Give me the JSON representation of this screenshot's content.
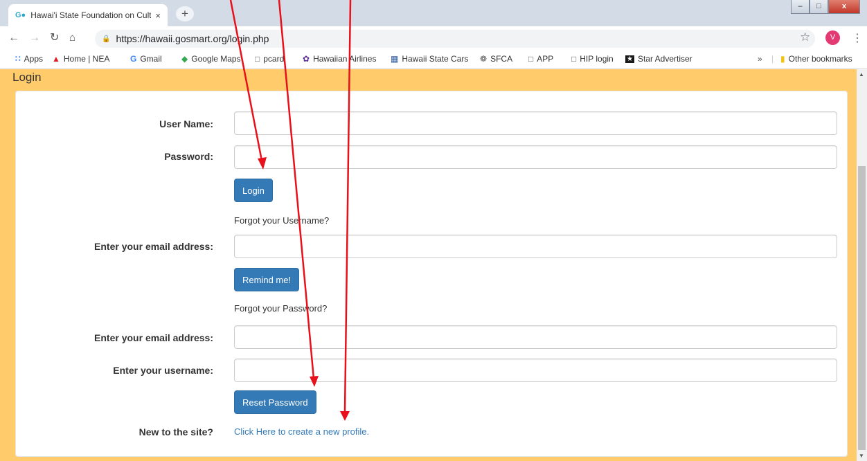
{
  "browser": {
    "tab_title": "Hawai'i State Foundation on Cult",
    "tab_favicon": "G●",
    "tab_close": "×",
    "new_tab": "+",
    "url": "https://hawaii.gosmart.org/login.php",
    "profile_initial": "V",
    "window_controls": {
      "minimize": "–",
      "maximize": "□",
      "close": "x"
    }
  },
  "bookmarks": {
    "items": [
      {
        "label": "Apps",
        "icon": "apps-grid-icon"
      },
      {
        "label": "Home | NEA",
        "icon": "nea-icon"
      },
      {
        "label": "Gmail",
        "icon": "google-icon"
      },
      {
        "label": "Google Maps",
        "icon": "maps-icon"
      },
      {
        "label": "pcard",
        "icon": "page-icon"
      },
      {
        "label": "Hawaiian Airlines",
        "icon": "airline-icon"
      },
      {
        "label": "Hawaii State Cars",
        "icon": "car-icon"
      },
      {
        "label": "SFCA",
        "icon": "sfca-icon"
      },
      {
        "label": "APP",
        "icon": "page-icon"
      },
      {
        "label": "HIP login",
        "icon": "page-icon"
      },
      {
        "label": "Star Advertiser",
        "icon": "star-advertiser-icon"
      }
    ],
    "overflow": "»",
    "other": "Other bookmarks"
  },
  "page": {
    "panel_title": "Login",
    "username_label": "User Name:",
    "password_label": "Password:",
    "login_button": "Login",
    "forgot_username_text": "Forgot your Username?",
    "remind_email_label": "Enter your email address:",
    "remind_button": "Remind me!",
    "forgot_password_text": "Forgot your Password?",
    "reset_email_label": "Enter your email address:",
    "reset_username_label": "Enter your username:",
    "reset_button": "Reset Password",
    "new_site_label": "New to the site?",
    "create_profile_link": "Click Here to create a new profile."
  },
  "colors": {
    "page_background": "#ffcb6b",
    "button_primary": "#337ab7",
    "link": "#337ab7",
    "annotation_arrow": "#e8101a"
  }
}
